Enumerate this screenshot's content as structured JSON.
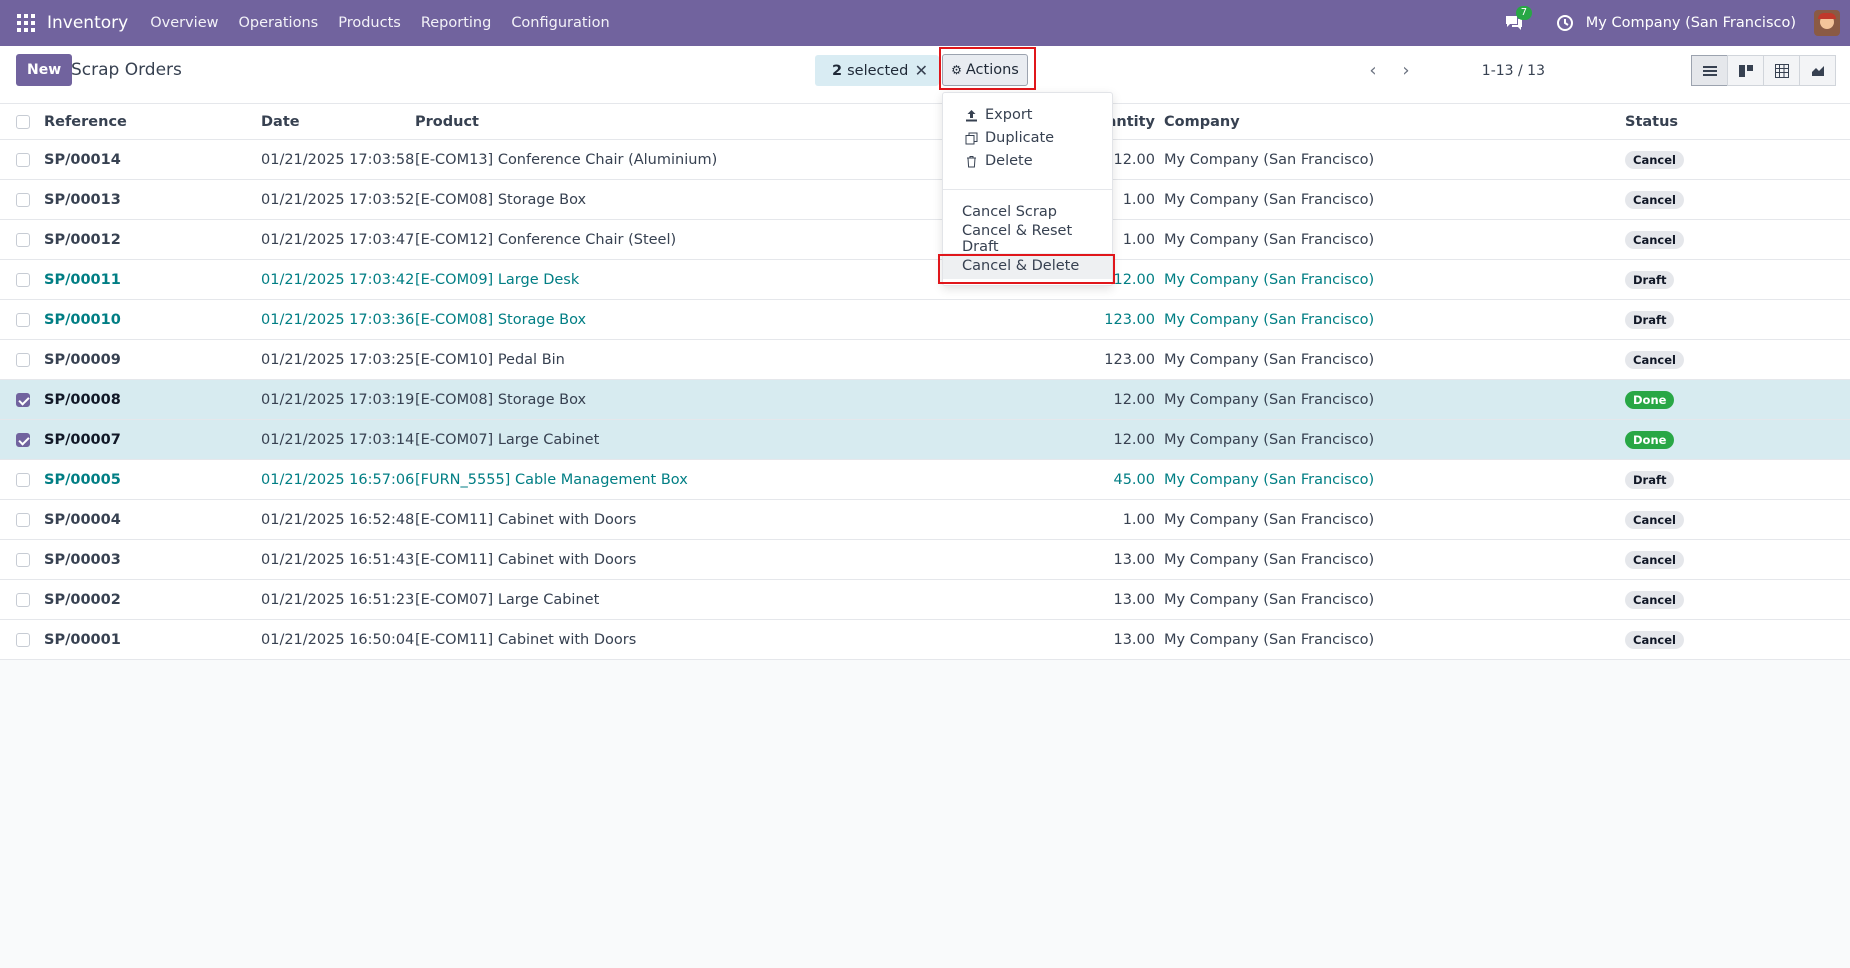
{
  "navbar": {
    "app_name": "Inventory",
    "menu": [
      "Overview",
      "Operations",
      "Products",
      "Reporting",
      "Configuration"
    ],
    "chat_count": "7",
    "company": "My Company (San Francisco)"
  },
  "control": {
    "new_label": "New",
    "title": "Scrap Orders",
    "selected_count": "2",
    "selected_label": "selected",
    "actions_label": "Actions",
    "pager": "1-13 / 13"
  },
  "columns": {
    "reference": "Reference",
    "date": "Date",
    "product": "Product",
    "quantity": "uantity",
    "company": "Company",
    "status": "Status"
  },
  "rows": [
    {
      "ref": "SP/00014",
      "date": "01/21/2025 17:03:58",
      "product": "[E-COM13] Conference Chair (Aluminium)",
      "qty": "12.00",
      "company": "My Company (San Francisco)",
      "status": "Cancel",
      "checked": false
    },
    {
      "ref": "SP/00013",
      "date": "01/21/2025 17:03:52",
      "product": "[E-COM08] Storage Box",
      "qty": "1.00",
      "company": "My Company (San Francisco)",
      "status": "Cancel",
      "checked": false
    },
    {
      "ref": "SP/00012",
      "date": "01/21/2025 17:03:47",
      "product": "[E-COM12] Conference Chair (Steel)",
      "qty": "1.00",
      "company": "My Company (San Francisco)",
      "status": "Cancel",
      "checked": false
    },
    {
      "ref": "SP/00011",
      "date": "01/21/2025 17:03:42",
      "product": "[E-COM09] Large Desk",
      "qty": "12.00",
      "company": "My Company (San Francisco)",
      "status": "Draft",
      "checked": false
    },
    {
      "ref": "SP/00010",
      "date": "01/21/2025 17:03:36",
      "product": "[E-COM08] Storage Box",
      "qty": "123.00",
      "company": "My Company (San Francisco)",
      "status": "Draft",
      "checked": false
    },
    {
      "ref": "SP/00009",
      "date": "01/21/2025 17:03:25",
      "product": "[E-COM10] Pedal Bin",
      "qty": "123.00",
      "company": "My Company (San Francisco)",
      "status": "Cancel",
      "checked": false
    },
    {
      "ref": "SP/00008",
      "date": "01/21/2025 17:03:19",
      "product": "[E-COM08] Storage Box",
      "qty": "12.00",
      "company": "My Company (San Francisco)",
      "status": "Done",
      "checked": true
    },
    {
      "ref": "SP/00007",
      "date": "01/21/2025 17:03:14",
      "product": "[E-COM07] Large Cabinet",
      "qty": "12.00",
      "company": "My Company (San Francisco)",
      "status": "Done",
      "checked": true
    },
    {
      "ref": "SP/00005",
      "date": "01/21/2025 16:57:06",
      "product": "[FURN_5555] Cable Management Box",
      "qty": "45.00",
      "company": "My Company (San Francisco)",
      "status": "Draft",
      "checked": false
    },
    {
      "ref": "SP/00004",
      "date": "01/21/2025 16:52:48",
      "product": "[E-COM11] Cabinet with Doors",
      "qty": "1.00",
      "company": "My Company (San Francisco)",
      "status": "Cancel",
      "checked": false
    },
    {
      "ref": "SP/00003",
      "date": "01/21/2025 16:51:43",
      "product": "[E-COM11] Cabinet with Doors",
      "qty": "13.00",
      "company": "My Company (San Francisco)",
      "status": "Cancel",
      "checked": false
    },
    {
      "ref": "SP/00002",
      "date": "01/21/2025 16:51:23",
      "product": "[E-COM07] Large Cabinet",
      "qty": "13.00",
      "company": "My Company (San Francisco)",
      "status": "Cancel",
      "checked": false
    },
    {
      "ref": "SP/00001",
      "date": "01/21/2025 16:50:04",
      "product": "[E-COM11] Cabinet with Doors",
      "qty": "13.00",
      "company": "My Company (San Francisco)",
      "status": "Cancel",
      "checked": false
    }
  ],
  "actions_menu": {
    "export": "Export",
    "duplicate": "Duplicate",
    "delete": "Delete",
    "cancel_scrap": "Cancel Scrap",
    "cancel_reset_draft": "Cancel & Reset Draft",
    "cancel_delete": "Cancel & Delete"
  },
  "colors": {
    "brand": "#71639e",
    "link": "#017e84",
    "selected_row": "#d7ebf0",
    "done": "#28a745",
    "highlight": "#e0161b"
  },
  "icons": {
    "apps": "apps-grid-icon",
    "chat": "chat-icon",
    "activity": "clock-icon",
    "actions": "gear-icon",
    "export": "upload-icon",
    "duplicate": "copy-icon",
    "delete": "trash-icon"
  }
}
